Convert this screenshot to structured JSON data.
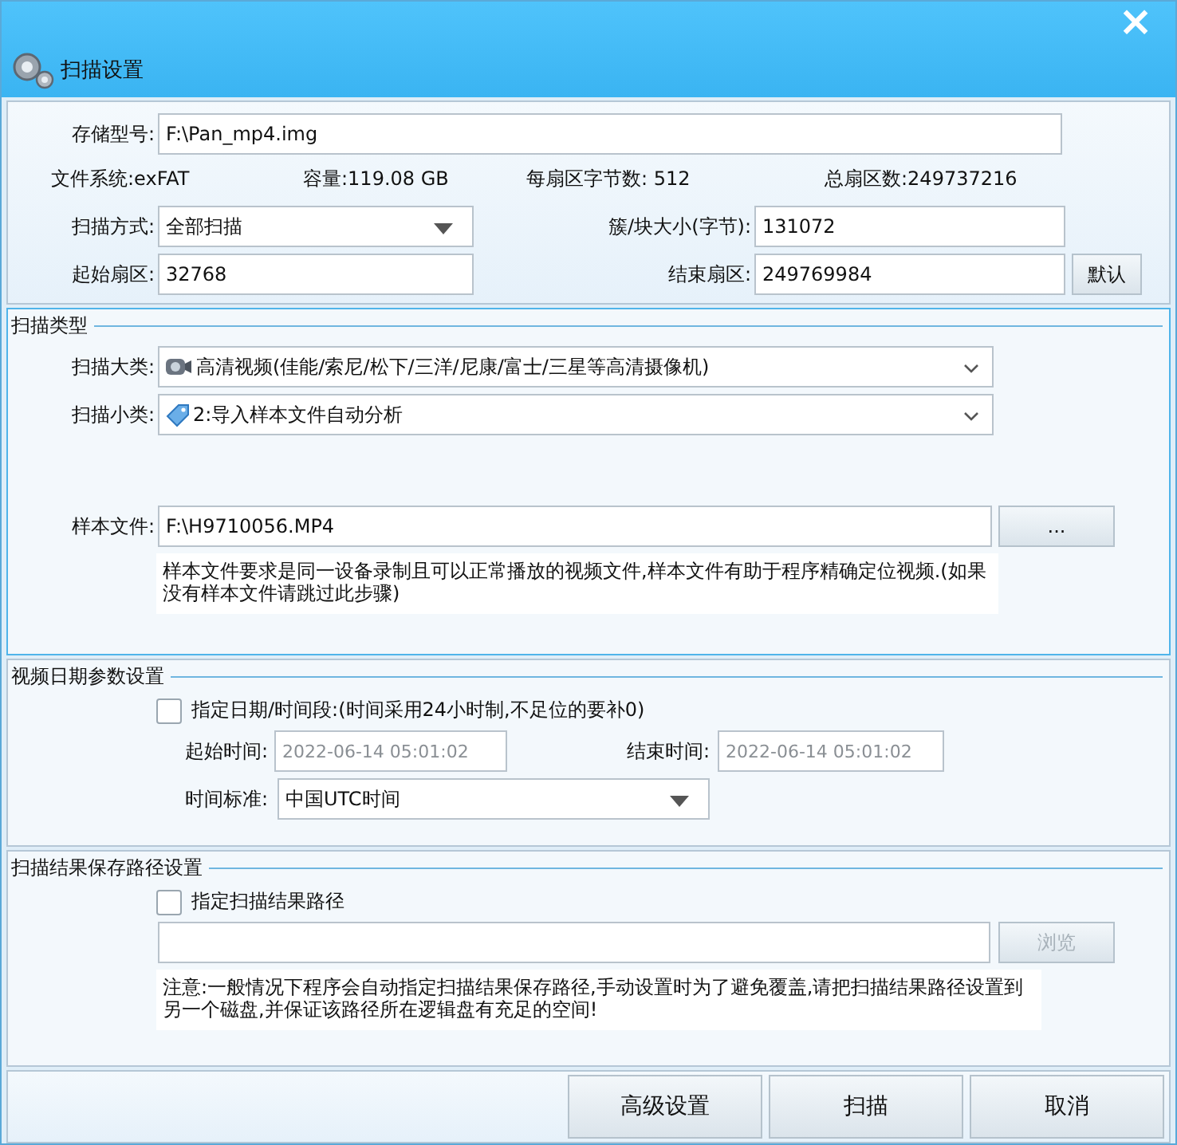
{
  "window": {
    "title": "扫描设置",
    "close": "×"
  },
  "storage": {
    "label": "存储型号:",
    "value": "F:\\Pan_mp4.img"
  },
  "info": [
    "文件系统:exFAT",
    "容量:119.08 GB",
    "每扇区字节数: 512",
    "总扇区数:249737216"
  ],
  "scan_mode": {
    "label": "扫描方式:",
    "value": "全部扫描"
  },
  "cluster": {
    "label": "簇/块大小(字节):",
    "value": "131072"
  },
  "start_sector": {
    "label": "起始扇区:",
    "value": "32768"
  },
  "end_sector": {
    "label": "结束扇区:",
    "value": "249769984"
  },
  "default_button": "默认",
  "scan_type": {
    "legend": "扫描类型",
    "focused": true,
    "major": {
      "label": "扫描大类:",
      "value": "高清视频(佳能/索尼/松下/三洋/尼康/富士/三星等高清摄像机)"
    },
    "minor": {
      "label": "扫描小类:",
      "value": "2:导入样本文件自动分析"
    },
    "sample": {
      "label": "样本文件:",
      "value": "F:\\H9710056.MP4",
      "button": "..."
    },
    "note": "样本文件要求是同一设备录制且可以正常播放的视频文件,样本文件有助于程序精确定位视频.(如果没有样本文件请跳过此步骤)"
  },
  "date": {
    "legend": "视频日期参数设置",
    "checkbox": {
      "label": "指定日期/时间段:(时间采用24小时制,不足位的要补0)",
      "checked": false
    },
    "start": {
      "label": "起始时间:",
      "value": "2022-06-14 05:01:02",
      "disabled": true
    },
    "end": {
      "label": "结束时间:",
      "value": "2022-06-14 05:01:02",
      "disabled": true
    },
    "standard": {
      "label": "时间标准:",
      "value": "中国UTC时间"
    }
  },
  "path": {
    "legend": "扫描结果保存路径设置",
    "checkbox": {
      "label": "指定扫描结果路径",
      "checked": false
    },
    "browse": {
      "label": "浏览",
      "disabled": true
    },
    "note": "注意:一般情况下程序会自动指定扫描结果保存路径,手动设置时为了避免覆盖,请把扫描结果路径设置到另一个磁盘,并保证该路径所在逻辑盘有充足的空间!"
  },
  "buttons": [
    "高级设置",
    "扫描",
    "取消"
  ]
}
